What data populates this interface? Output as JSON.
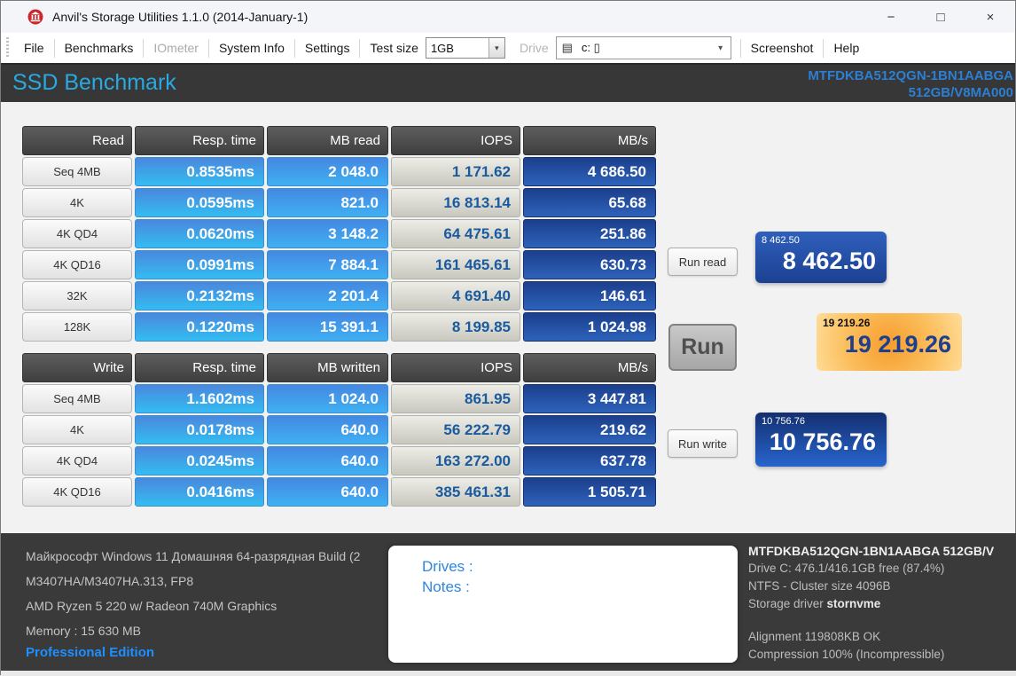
{
  "window": {
    "title": "Anvil's Storage Utilities 1.1.0 (2014-January-1)",
    "minimize": "−",
    "maximize": "□",
    "close": "×"
  },
  "menu": {
    "file": "File",
    "benchmarks": "Benchmarks",
    "iometer": "IOmeter",
    "system_info": "System Info",
    "settings": "Settings",
    "test_size_label": "Test size",
    "test_size_value": "1GB",
    "dropdown_arrow": "▾",
    "drive_label": "Drive",
    "drive_icon": "▤",
    "drive_value": "c: ▯",
    "screenshot": "Screenshot",
    "help": "Help"
  },
  "header": {
    "title": "SSD Benchmark",
    "model_line1": "MTFDKBA512QGN-1BN1AABGA",
    "model_line2": "512GB/V8MA000"
  },
  "read_table": {
    "headers": [
      "Read",
      "Resp. time",
      "MB read",
      "IOPS",
      "MB/s"
    ],
    "rows": [
      {
        "label": "Seq 4MB",
        "resp": "0.8535ms",
        "mb": "2 048.0",
        "iops": "1 171.62",
        "mbs": "4 686.50"
      },
      {
        "label": "4K",
        "resp": "0.0595ms",
        "mb": "821.0",
        "iops": "16 813.14",
        "mbs": "65.68"
      },
      {
        "label": "4K QD4",
        "resp": "0.0620ms",
        "mb": "3 148.2",
        "iops": "64 475.61",
        "mbs": "251.86"
      },
      {
        "label": "4K QD16",
        "resp": "0.0991ms",
        "mb": "7 884.1",
        "iops": "161 465.61",
        "mbs": "630.73"
      },
      {
        "label": "32K",
        "resp": "0.2132ms",
        "mb": "2 201.4",
        "iops": "4 691.40",
        "mbs": "146.61"
      },
      {
        "label": "128K",
        "resp": "0.1220ms",
        "mb": "15 391.1",
        "iops": "8 199.85",
        "mbs": "1 024.98"
      }
    ]
  },
  "write_table": {
    "headers": [
      "Write",
      "Resp. time",
      "MB written",
      "IOPS",
      "MB/s"
    ],
    "rows": [
      {
        "label": "Seq 4MB",
        "resp": "1.1602ms",
        "mb": "1 024.0",
        "iops": "861.95",
        "mbs": "3 447.81"
      },
      {
        "label": "4K",
        "resp": "0.0178ms",
        "mb": "640.0",
        "iops": "56 222.79",
        "mbs": "219.62"
      },
      {
        "label": "4K QD4",
        "resp": "0.0245ms",
        "mb": "640.0",
        "iops": "163 272.00",
        "mbs": "637.78"
      },
      {
        "label": "4K QD16",
        "resp": "0.0416ms",
        "mb": "640.0",
        "iops": "385 461.31",
        "mbs": "1 505.71"
      }
    ]
  },
  "actions": {
    "run_read": "Run read",
    "run": "Run",
    "run_write": "Run write"
  },
  "scores": {
    "read_small": "8 462.50",
    "read_large": "8 462.50",
    "total_small": "19 219.26",
    "total_large": "19 219.26",
    "write_small": "10 756.76",
    "write_large": "10 756.76"
  },
  "system_info": {
    "os": "Майкрософт Windows 11 Домашняя 64-разрядная Build (2",
    "board": "M3407HA/M3407HA.313, FP8",
    "cpu": "AMD Ryzen 5 220 w/ Radeon 740M Graphics",
    "memory": "Memory : 15 630 MB",
    "edition": "Professional Edition"
  },
  "notes_panel": {
    "drives_label": "Drives :",
    "notes_label": "Notes :"
  },
  "drive_info": {
    "model": "MTFDKBA512QGN-1BN1AABGA 512GB/V",
    "capacity": "Drive C: 476.1/416.1GB free (87.4%)",
    "filesystem": "NTFS - Cluster size 4096B",
    "storage_driver_label": "Storage driver ",
    "storage_driver_value": "stornvme",
    "alignment": "Alignment 119808KB OK",
    "compression": "Compression 100% (Incompressible)"
  },
  "colors": {
    "accent_cyan": "#29a9e1",
    "model_blue": "#2b7fd4",
    "cell_blue_top": "#4b87dd",
    "cell_cyan_bottom": "#33bdf1",
    "cell_navy": "#1c3e8d",
    "iops_text": "#1a5a9e",
    "score_orange": "#f69d2e",
    "edition_blue": "#1e8fff",
    "dark_panel": "#3a3a3a"
  }
}
